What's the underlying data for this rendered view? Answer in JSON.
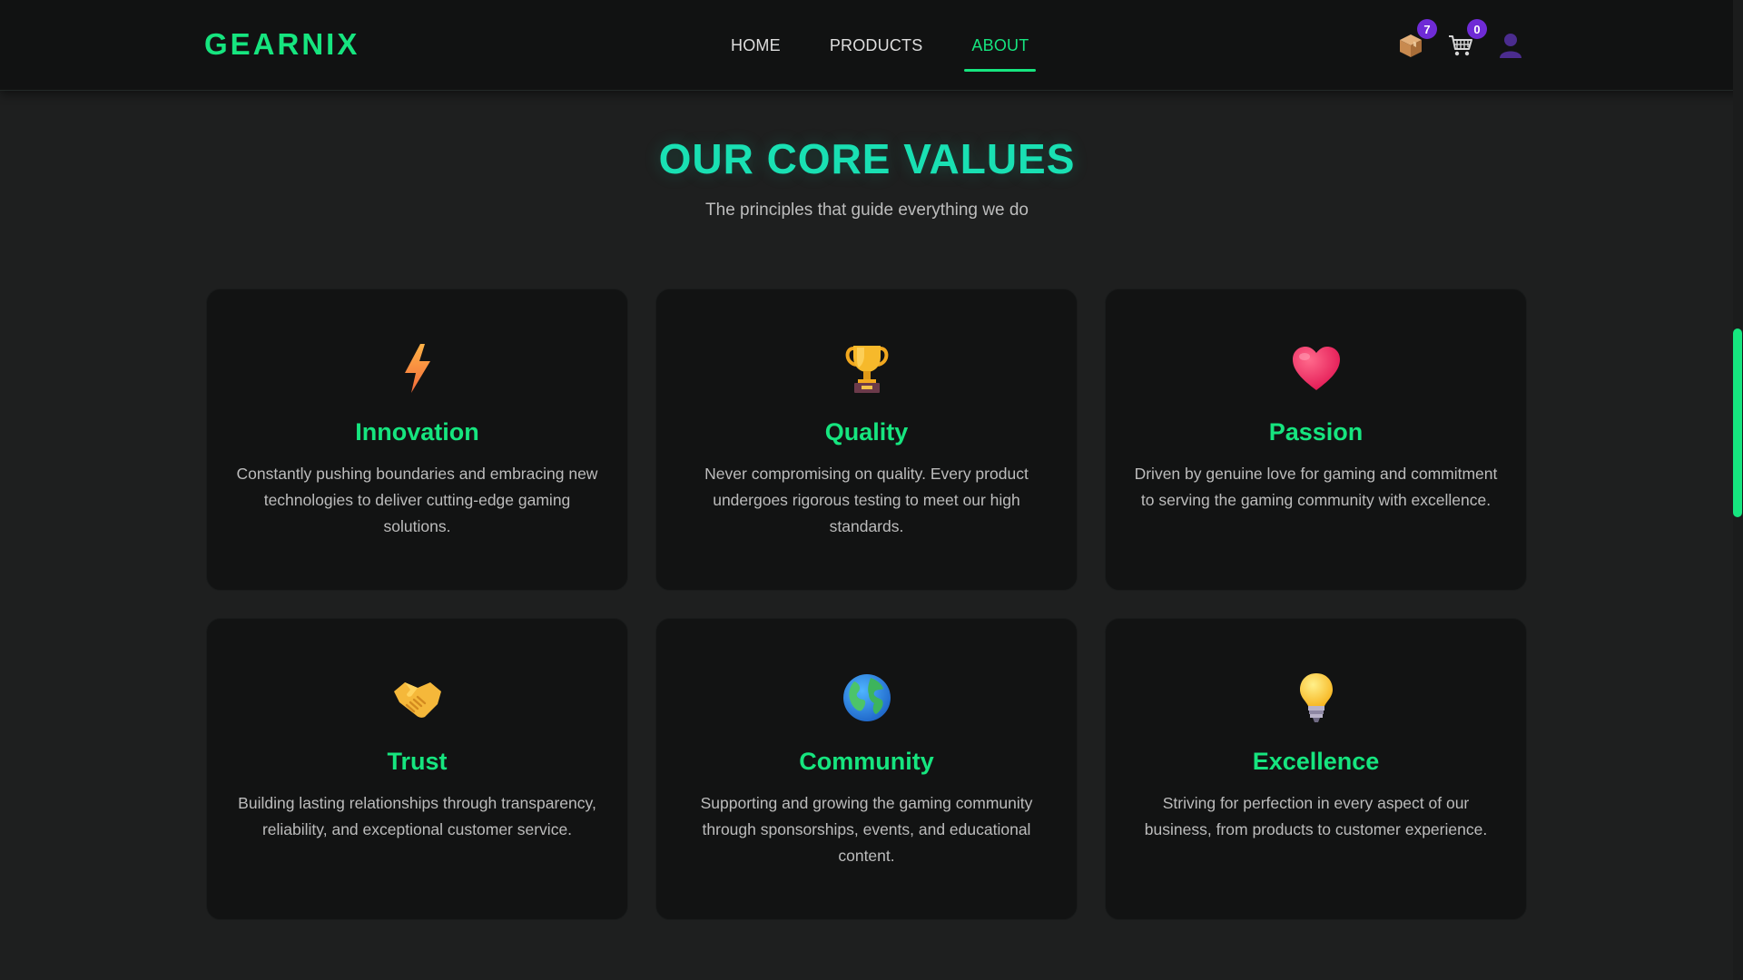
{
  "brand": {
    "logo": "GEARNIX",
    "accent": "#16e57f",
    "headline": "#19e0b3",
    "badge": "#6f2bd6"
  },
  "nav": {
    "links": [
      {
        "label": "HOME",
        "active": false
      },
      {
        "label": "PRODUCTS",
        "active": false
      },
      {
        "label": "ABOUT",
        "active": true
      }
    ],
    "icons": [
      {
        "name": "orders-box-icon",
        "badge": "7"
      },
      {
        "name": "cart-icon",
        "badge": "0"
      },
      {
        "name": "user-icon",
        "badge": null
      }
    ]
  },
  "section": {
    "title": "OUR CORE VALUES",
    "subtitle": "The principles that guide everything we do"
  },
  "values": [
    {
      "icon": "lightning-bolt-icon",
      "title": "Innovation",
      "description": "Constantly pushing boundaries and embracing new technologies to deliver cutting-edge gaming solutions."
    },
    {
      "icon": "trophy-icon",
      "title": "Quality",
      "description": "Never compromising on quality. Every product undergoes rigorous testing to meet our high standards."
    },
    {
      "icon": "heart-icon",
      "title": "Passion",
      "description": "Driven by genuine love for gaming and commitment to serving the gaming community with excellence."
    },
    {
      "icon": "handshake-icon",
      "title": "Trust",
      "description": "Building lasting relationships through transparency, reliability, and exceptional customer service."
    },
    {
      "icon": "globe-icon",
      "title": "Community",
      "description": "Supporting and growing the gaming community through sponsorships, events, and educational content."
    },
    {
      "icon": "light-bulb-icon",
      "title": "Excellence",
      "description": "Striving for perfection in every aspect of our business, from products to customer experience."
    }
  ]
}
